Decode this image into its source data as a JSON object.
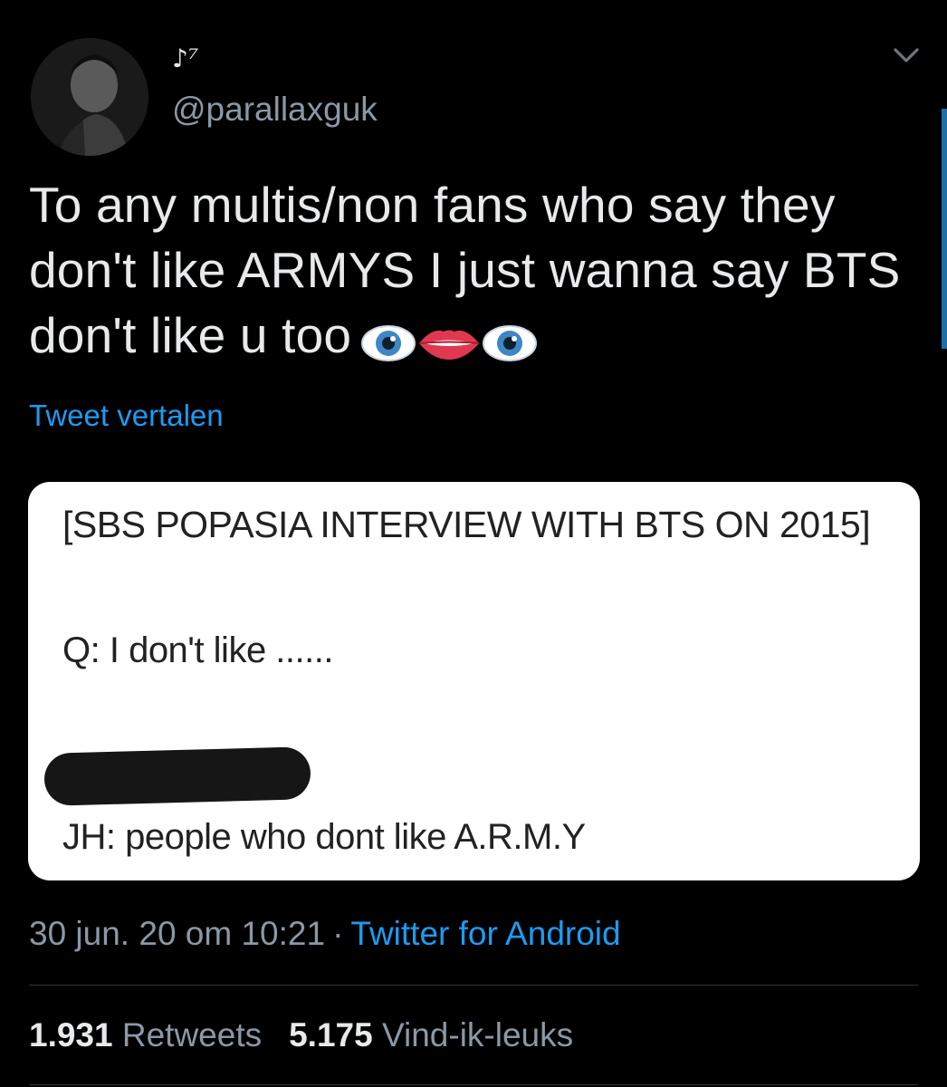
{
  "author": {
    "display_name": "♪⁷",
    "handle": "@parallaxguk"
  },
  "tweet": {
    "text": "To any multis/non fans who say they don't like ARMYS I just wanna say BTS don't like u too",
    "emojis": [
      "eye-emoji",
      "lips-emoji",
      "eye-emoji"
    ],
    "translate_label": "Tweet vertalen"
  },
  "media": {
    "title": "[SBS POPASIA INTERVIEW WITH BTS ON 2015]",
    "question": "Q: I don't like ......",
    "answer": "JH: people who dont like A.R.M.Y"
  },
  "meta": {
    "timestamp": "30 jun. 20 om 10:21",
    "separator": "·",
    "source": "Twitter for Android"
  },
  "stats": {
    "retweets_count": "1.931",
    "retweets_label": "Retweets",
    "likes_count": "5.175",
    "likes_label": "Vind-ik-leuks"
  },
  "colors": {
    "background": "#000000",
    "link": "#1d9bf0",
    "secondary_text": "#8b98a5",
    "primary_text": "#e7e9ea"
  }
}
